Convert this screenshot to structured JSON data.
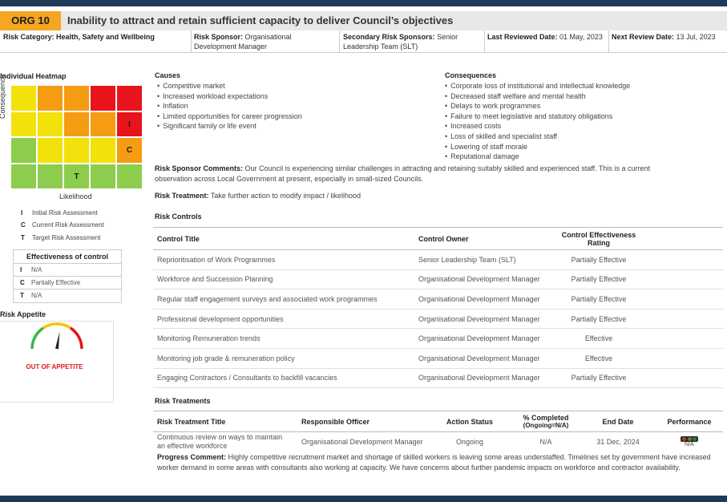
{
  "header": {
    "org_code": "ORG 10",
    "title": "Inability to attract and retain sufficient capacity to deliver Council’s objectives"
  },
  "meta": {
    "category_label": "Risk Category:",
    "category_value": "Health, Safety and Wellbeing",
    "sponsor_label": "Risk Sponsor:",
    "sponsor_value": "Organisational",
    "sponsor_value_2": "Development Manager",
    "secondary_label": "Secondary Risk Sponsors:",
    "secondary_value": "Senior",
    "secondary_value_2": "Leadership Team (SLT)",
    "reviewed_label": "Last Reviewed Date:",
    "reviewed_value": "01 May, 2023",
    "next_label": "Next Review Date:",
    "next_value": "13 Jul, 2023"
  },
  "heatmap": {
    "title": "Individual Heatmap",
    "y_label": "Consequence",
    "x_label": "Likelihood",
    "colors": {
      "red": "#e8141c",
      "orange": "#f59c12",
      "yellow": "#f2e10a",
      "green": "#8ccd4e"
    },
    "grid": [
      [
        "yellow",
        "orange",
        "orange",
        "red",
        "red"
      ],
      [
        "yellow",
        "yellow",
        "orange",
        "orange",
        "red"
      ],
      [
        "green",
        "yellow",
        "yellow",
        "yellow",
        "orange"
      ],
      [
        "green",
        "green",
        "green",
        "green",
        "green"
      ]
    ],
    "markers": [
      {
        "row": 1,
        "col": 4,
        "text": "I"
      },
      {
        "row": 2,
        "col": 4,
        "text": "C"
      },
      {
        "row": 3,
        "col": 2,
        "text": "T"
      }
    ]
  },
  "legend": [
    {
      "key": "I",
      "label": "Initial  Risk Assessment"
    },
    {
      "key": "C",
      "label": "Current  Risk Assessment"
    },
    {
      "key": "T",
      "label": "Target  Risk Assessment"
    }
  ],
  "effectiveness": {
    "title": "Effectiveness of control",
    "rows": [
      {
        "key": "I",
        "value": "N/A"
      },
      {
        "key": "C",
        "value": "Partially Effective"
      },
      {
        "key": "T",
        "value": "N/A"
      }
    ]
  },
  "appetite": {
    "title": "Risk Appetite",
    "status": "OUT OF APPETITE",
    "level": 0.55
  },
  "causes": {
    "title": "Causes",
    "items": [
      "Competitive market",
      "Increased workload expectations",
      "Inflation",
      "Limited opportunities for career progression",
      "Significant family or life event"
    ]
  },
  "consequences": {
    "title": "Consequences",
    "items": [
      "Corporate loss of institutional and intellectual knowledge",
      "Decreased staff welfare and mental health",
      "Delays to work programmes",
      "Failure to meet legislative and statutory obligations",
      "Increased costs",
      "Loss of skilled and specialist staff",
      "Lowering of staff morale",
      "Reputational damage"
    ]
  },
  "sponsor_comments": {
    "label": "Risk Sponsor Comments:",
    "text": "Our Council is experiencing similar challenges in attracting and retaining suitably skilled and experienced staff. This is a current observation across Local Government at present, especially in small-sized Councils."
  },
  "risk_treatment": {
    "label": "Risk Treatment:",
    "text": "Take further action to modify impact / likelihood"
  },
  "controls": {
    "title": "Risk Controls",
    "headers": {
      "title": "Control Title",
      "owner": "Control Owner",
      "rating_1": "Control Effectiveness",
      "rating_2": "Rating"
    },
    "rows": [
      {
        "title": "Reprioritisation of Work Programmes",
        "owner": "Senior Leadership Team (SLT)",
        "rating": "Partially Effective"
      },
      {
        "title": "Workforce and Succession Planning",
        "owner": "Organisational Development Manager",
        "rating": "Partially Effective"
      },
      {
        "title": "Regular staff engagement surveys and associated work programmes",
        "owner": "Organisational Development Manager",
        "rating": "Partially Effective"
      },
      {
        "title": "Professional development opportunities",
        "owner": "Organisational Development Manager",
        "rating": "Partially Effective"
      },
      {
        "title": "Monitoring Remuneration trends",
        "owner": "Organisational Development Manager",
        "rating": "Effective"
      },
      {
        "title": "Monitoring job grade & remuneration policy",
        "owner": "Organisational Development Manager",
        "rating": "Effective"
      },
      {
        "title": "Engaging Contractors / Consultants to backfill vacancies",
        "owner": "Organisational Development Manager",
        "rating": "Partially Effective"
      }
    ]
  },
  "treatments": {
    "title": "Risk Treatments",
    "headers": {
      "title": "Risk Treatment Title",
      "officer": "Responsible Officer",
      "status": "Action Status",
      "pct_1": "% Completed",
      "pct_2": "(Ongoing=N/A)",
      "end": "End Date",
      "perf": "Performance"
    },
    "row": {
      "title_1": "Continuous review on ways to maintain",
      "title_2": "an effective workforce",
      "officer": "Organisational Development Manager",
      "status": "Ongoing",
      "pct": "N/A",
      "end": "31 Dec, 2024",
      "perf": "N/A"
    },
    "progress_label": "Progress Comment:",
    "progress_text": "Highly competitive recruitment market and shortage of skilled workers is leaving some areas understaffed. Timelines set by government have increased worker demand in some areas with consultants also working at capacity. We have concerns about further pandemic impacts on workforce and contractor availability."
  }
}
